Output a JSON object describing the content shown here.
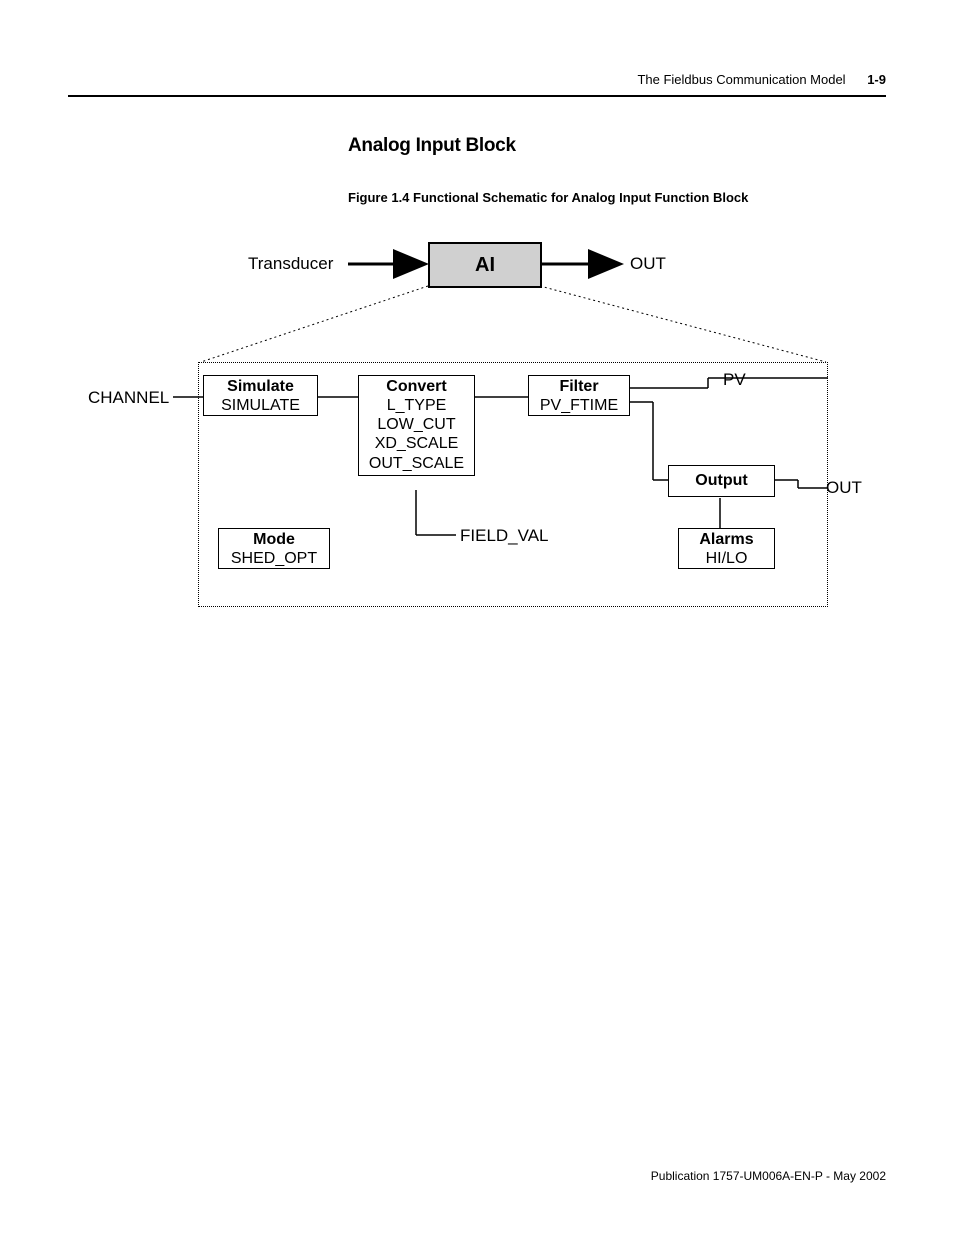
{
  "header": {
    "chapter": "The Fieldbus Communication Model",
    "page": "1-9"
  },
  "section_title": "Analog Input Block",
  "figure_caption": "Figure 1.4  Functional Schematic for Analog Input Function Block",
  "top": {
    "input_label": "Transducer",
    "block_label": "AI",
    "output_label": "OUT"
  },
  "side_labels": {
    "channel": "CHANNEL",
    "pv": "PV",
    "out": "OUT",
    "field_val": "FIELD_VAL"
  },
  "blocks": {
    "simulate": {
      "title": "Simulate",
      "params": [
        "SIMULATE"
      ]
    },
    "convert": {
      "title": "Convert",
      "params": [
        "L_TYPE",
        "LOW_CUT",
        "XD_SCALE",
        "OUT_SCALE"
      ]
    },
    "filter": {
      "title": "Filter",
      "params": [
        "PV_FTIME"
      ]
    },
    "output": {
      "title": "Output",
      "params": []
    },
    "mode": {
      "title": "Mode",
      "params": [
        "SHED_OPT"
      ]
    },
    "alarms": {
      "title": "Alarms",
      "params": [
        "HI/LO"
      ]
    }
  },
  "footer": "Publication 1757-UM006A-EN-P - May 2002"
}
